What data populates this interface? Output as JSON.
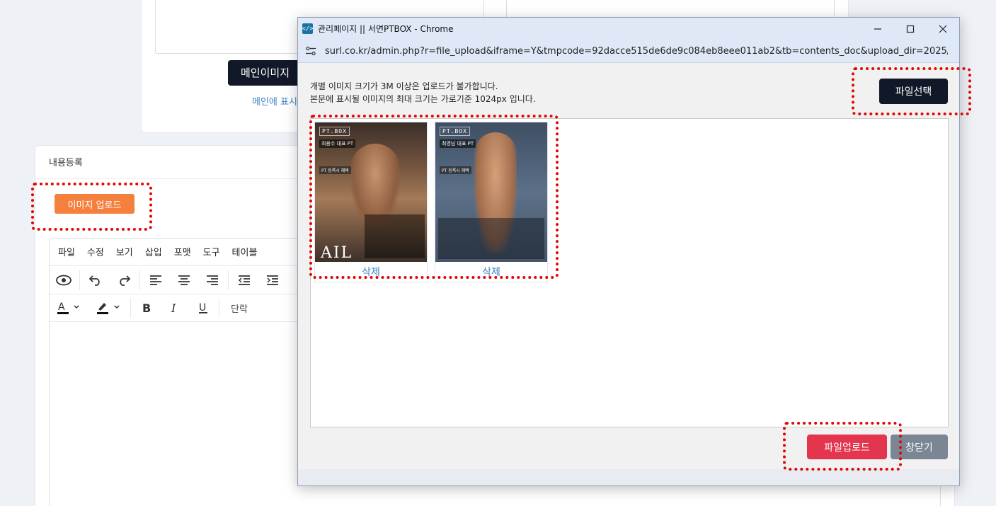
{
  "background": {
    "main_image_button": "메인이미지",
    "main_link": "메인에 표시",
    "content_card_title": "내용등록",
    "image_upload_button": "이미지 업로드",
    "editor": {
      "menu": [
        "파일",
        "수정",
        "보기",
        "삽입",
        "포맷",
        "도구",
        "테이블"
      ],
      "toolbar_row1_icons": [
        "preview-icon",
        "undo-icon",
        "redo-icon",
        "align-left-icon",
        "align-center-icon",
        "align-right-icon",
        "outdent-icon",
        "indent-icon"
      ],
      "toolbar_row2_icons": [
        "text-color-icon",
        "highlight-color-icon",
        "bold-icon",
        "italic-icon",
        "underline-icon"
      ],
      "block_format": "단락"
    }
  },
  "popup": {
    "title": "관리페이지 || 서면PTBOX - Chrome",
    "url": "surl.co.kr/admin.php?r=file_upload&iframe=Y&tmpcode=92dacce515de6de9c084eb8eee011ab2&tb=contents_doc&upload_dir=2025/0...",
    "notice_line1": "개별 이미지 크기가 3M 이상은 업로드가 불가합니다.",
    "notice_line2": "본문에 표시될 이미지의 최대 크기는 가로기준 1024px 입니다.",
    "select_file_button": "파일선택",
    "thumbnails": [
      {
        "brand": "PT.BOX",
        "name": "최용수 대표 PT",
        "sub": "PT 등록시 혜택",
        "delete_label": "삭제",
        "bg": "#5a4638",
        "watermark": "AIL"
      },
      {
        "brand": "PT.BOX",
        "name": "최영남 대표 PT",
        "sub": "PT 등록시 혜택",
        "delete_label": "삭제",
        "bg": "#4f6277",
        "watermark": ""
      }
    ],
    "upload_button": "파일업로드",
    "close_button": "창닫기"
  },
  "colors": {
    "orange_button": "#f5803e",
    "dark_button": "#111827",
    "upload_button": "#e3364e",
    "close_button": "#7b8695",
    "highlight_dots": "#e10600",
    "link": "#3b82c4"
  }
}
